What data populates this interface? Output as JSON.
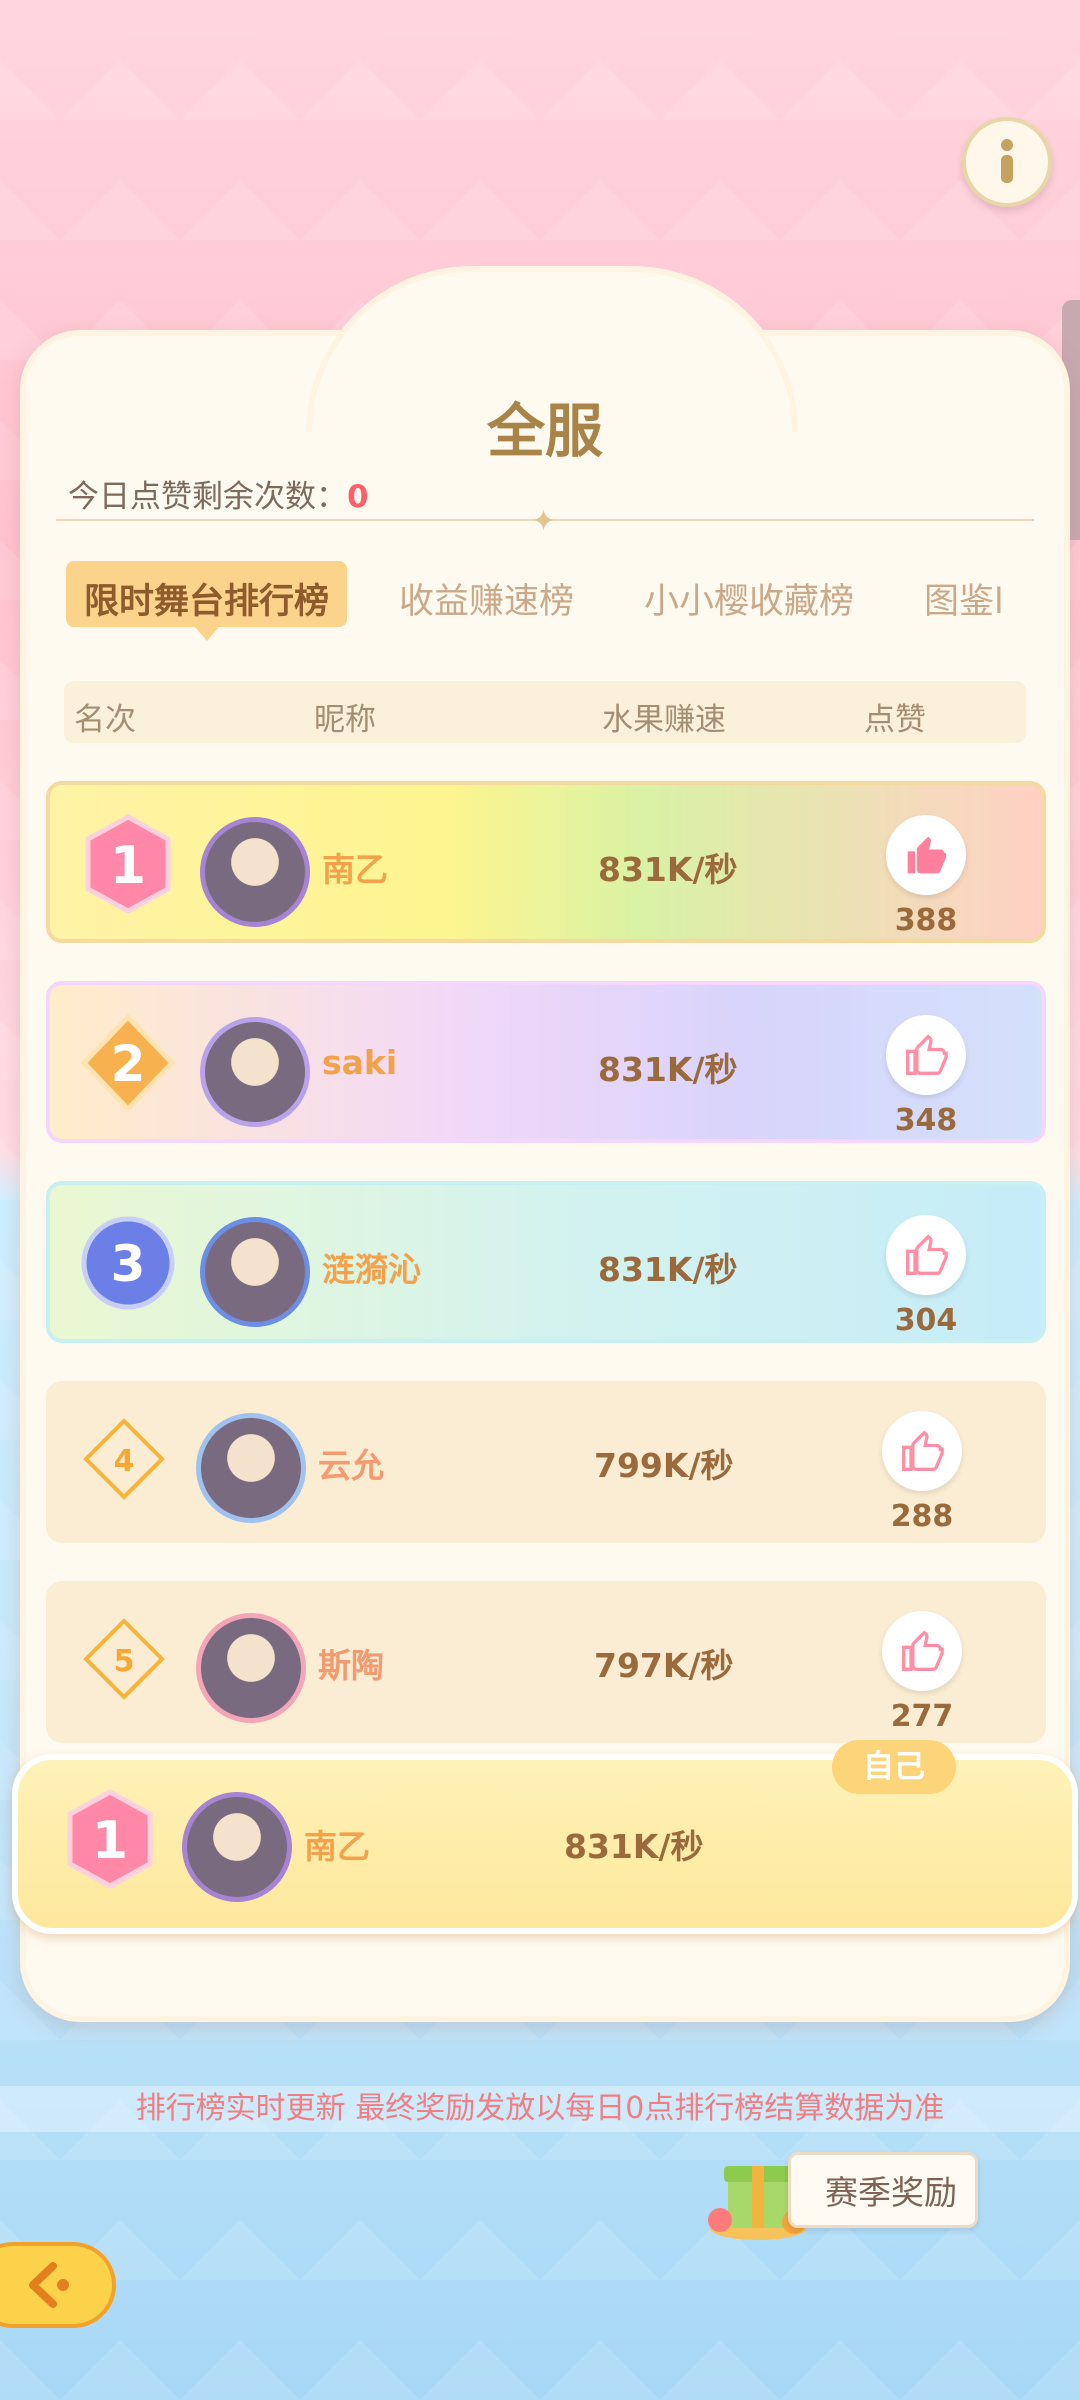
{
  "header": {
    "info_icon": "info-icon"
  },
  "panel": {
    "title": "全服",
    "likes_remaining_label": "今日点赞剩余次数：",
    "likes_remaining_value": "0"
  },
  "tabs": [
    {
      "label": "限时舞台排行榜",
      "active": true
    },
    {
      "label": "收益赚速榜",
      "active": false
    },
    {
      "label": "小小樱收藏榜",
      "active": false
    },
    {
      "label": "图鉴l",
      "active": false
    }
  ],
  "columns": {
    "rank": "名次",
    "nickname": "昵称",
    "speed": "水果赚速",
    "like": "点赞"
  },
  "rows": [
    {
      "rank": "1",
      "name": "南乙",
      "speed": "831K/秒",
      "likes": "388"
    },
    {
      "rank": "2",
      "name": "saki",
      "speed": "831K/秒",
      "likes": "348"
    },
    {
      "rank": "3",
      "name": "涟漪沁",
      "speed": "831K/秒",
      "likes": "304"
    },
    {
      "rank": "4",
      "name": "云允",
      "speed": "799K/秒",
      "likes": "288"
    },
    {
      "rank": "5",
      "name": "斯陶",
      "speed": "797K/秒",
      "likes": "277"
    }
  ],
  "self": {
    "badge": "自己",
    "rank": "1",
    "name": "南乙",
    "speed": "831K/秒"
  },
  "footer": {
    "notice": "排行榜实时更新 最终奖励发放以每日0点排行榜结算数据为准",
    "season_reward": "赛季奖励"
  },
  "colors": {
    "accent": "#fbd38a",
    "name": "#f3a24c",
    "speed": "#9a6a3c",
    "like": "#ff8fa6"
  }
}
